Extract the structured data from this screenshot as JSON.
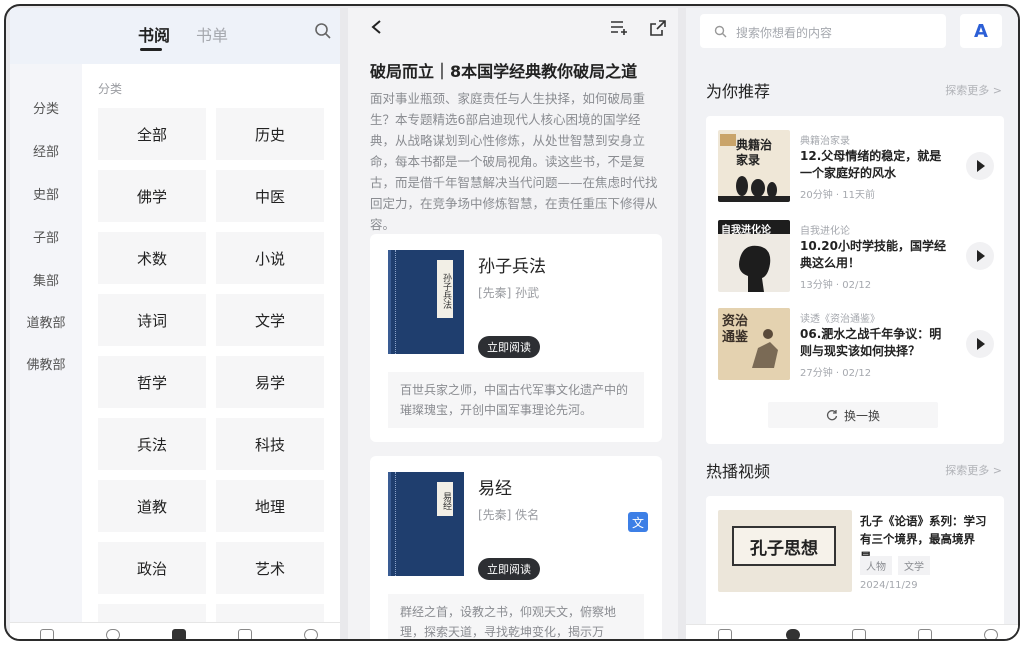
{
  "left_panel": {
    "tabs": [
      {
        "label": "书阅",
        "active": true
      },
      {
        "label": "书单",
        "active": false
      }
    ],
    "sidebar_categories": [
      "分类",
      "经部",
      "史部",
      "子部",
      "集部",
      "道教部",
      "佛教部"
    ],
    "section_label": "分类",
    "categories": [
      "全部",
      "历史",
      "佛学",
      "中医",
      "术数",
      "小说",
      "诗词",
      "文学",
      "哲学",
      "易学",
      "兵法",
      "科技",
      "道教",
      "地理",
      "政治",
      "艺术"
    ]
  },
  "middle_panel": {
    "title": "破局而立｜8本国学经典教你破局之道",
    "description": "面对事业瓶颈、家庭责任与人生抉择，如何破局重生？本专题精选6部启迪现代人核心困境的国学经典，从战略谋划到心性修炼，从处世智慧到安身立命，每本书都是一个破局视角。读这些书，不是复古，而是借千年智慧解决当代问题——在焦虑时代找回定力，在竞争场中修炼智慧，在责任重压下修得从容。",
    "books": [
      {
        "title": "孙子兵法",
        "cover_label": "孙子兵法",
        "author": "[先秦] 孙武",
        "read_label": "立即阅读",
        "summary": "百世兵家之师，中国古代军事文化遗产中的璀璨瑰宝，开创中国军事理论先河。"
      },
      {
        "title": "易经",
        "cover_label": "易经",
        "author": "[先秦] 佚名",
        "read_label": "立即阅读",
        "summary": "群经之首，设教之书，仰观天文，俯察地理，探索天道，寻找乾坤变化，揭示万"
      }
    ],
    "translate_icon_label": "文"
  },
  "right_panel": {
    "search_placeholder": "搜索你想看的内容",
    "ai_label": "A",
    "recommend_title": "为你推荐",
    "more_label": "探索更多 >",
    "recommendations": [
      {
        "thumb_text": "典籍治家录",
        "source": "典籍治家录",
        "title": "12.父母情绪的稳定，就是一个家庭好的风水",
        "meta": "20分钟 · 11天前"
      },
      {
        "thumb_text": "自我进化论",
        "source": "自我进化论",
        "title": "10.20小时学技能，国学经典这么用！",
        "meta": "13分钟 · 02/12"
      },
      {
        "thumb_text": "资治通鉴",
        "source": "读透《资治通鉴》",
        "title": "06.淝水之战千年争议：明则与现实该如何抉择？",
        "meta": "27分钟 · 02/12"
      }
    ],
    "refresh_label": "换一换",
    "video_title": "热播视频",
    "video": {
      "thumb_text": "孔子思想",
      "title": "孔子《论语》系列：学习有三个境界，最高境界是…",
      "tags": [
        "人物",
        "文学"
      ],
      "date": "2024/11/29"
    }
  },
  "colors": {
    "accent_blue": "#2c5fd6",
    "book_cover": "#1f3e6e",
    "dark_button": "#2d2f33"
  }
}
